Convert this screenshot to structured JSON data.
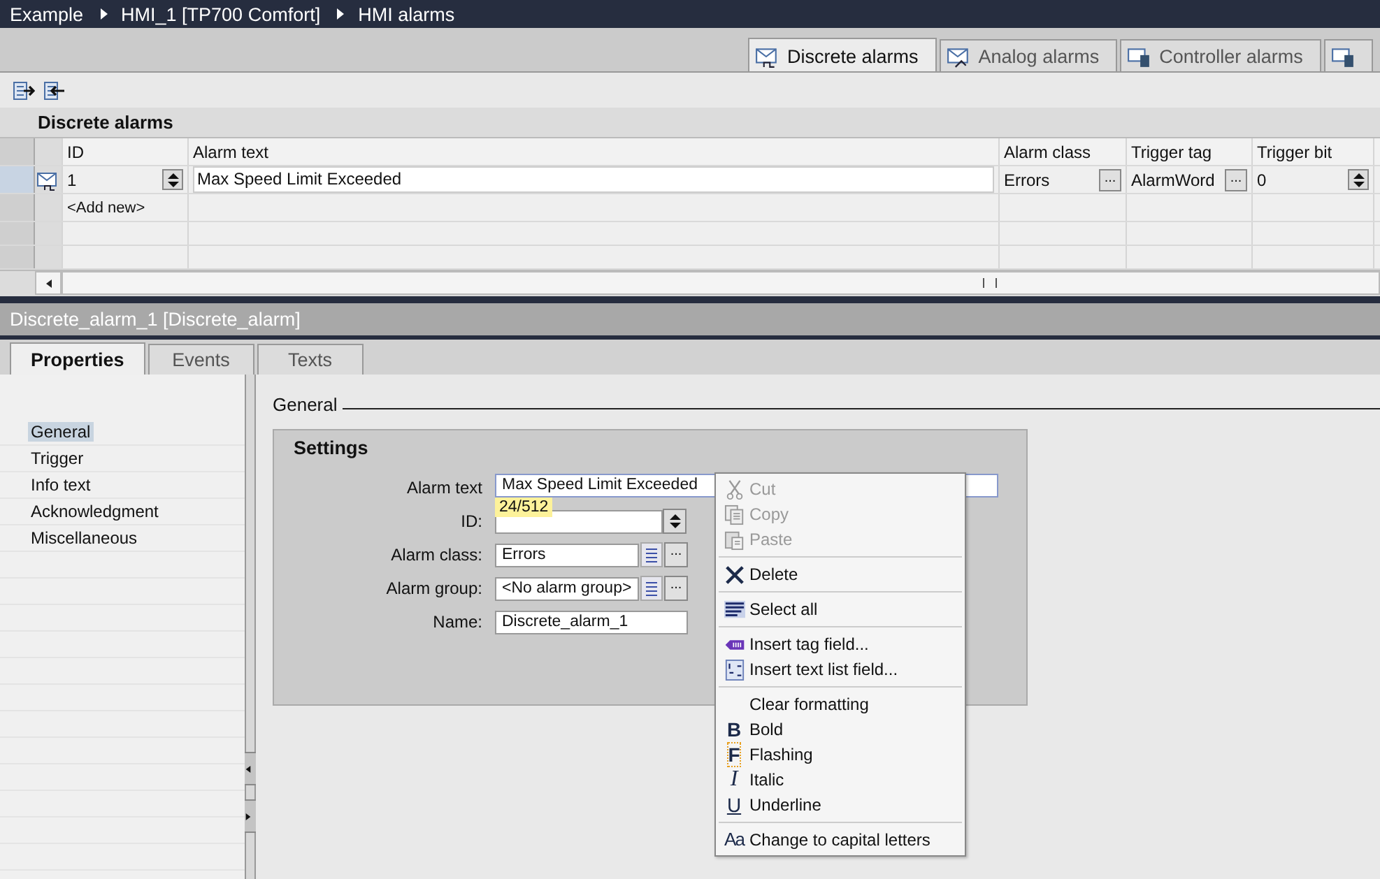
{
  "breadcrumb": [
    "Example",
    "HMI_1 [TP700 Comfort]",
    "HMI alarms"
  ],
  "editor_tabs": [
    {
      "label": "Discrete alarms",
      "selected": true
    },
    {
      "label": "Analog alarms",
      "selected": false
    },
    {
      "label": "Controller alarms",
      "selected": false
    },
    {
      "selected": false
    }
  ],
  "table": {
    "title": "Discrete alarms",
    "columns": [
      "ID",
      "Alarm text",
      "Alarm class",
      "Trigger tag",
      "Trigger bit"
    ],
    "rows": [
      {
        "id": "1",
        "alarm_text": "Max Speed Limit Exceeded",
        "alarm_class": "Errors",
        "alarm_class_button": "...",
        "trigger_tag": "AlarmWord",
        "trigger_tag_button": "...",
        "trigger_bit": "0",
        "selected": true
      }
    ],
    "add_new": "<Add new>"
  },
  "inspector": {
    "title": "Discrete_alarm_1 [Discrete_alarm]",
    "tabs": [
      {
        "label": "Properties",
        "selected": true
      },
      {
        "label": "Events",
        "selected": false
      },
      {
        "label": "Texts",
        "selected": false
      }
    ],
    "nav": [
      {
        "label": "General",
        "selected": true
      },
      {
        "label": "Trigger",
        "selected": false
      },
      {
        "label": "Info text",
        "selected": false
      },
      {
        "label": "Acknowledgment",
        "selected": false
      },
      {
        "label": "Miscellaneous",
        "selected": false
      }
    ],
    "section": "General",
    "group": "Settings",
    "fields": [
      {
        "label": "Alarm text",
        "kind": "wide",
        "value": "Max Speed Limit Exceeded",
        "counter": "24/512"
      },
      {
        "label": "ID:",
        "kind": "spin"
      },
      {
        "label": "Alarm class:",
        "kind": "picker",
        "value": "Errors",
        "button": "..."
      },
      {
        "label": "Alarm group:",
        "kind": "picker",
        "value": "<No alarm group>",
        "button": "..."
      },
      {
        "label": "Name:",
        "kind": "text",
        "value": "Discrete_alarm_1"
      }
    ]
  },
  "context_menu": [
    [
      {
        "label": "Cut",
        "disabled": true
      },
      {
        "label": "Copy",
        "disabled": true
      },
      {
        "label": "Paste",
        "disabled": true
      }
    ],
    [
      {
        "label": "Delete",
        "disabled": false
      }
    ],
    [
      {
        "label": "Select all",
        "disabled": false
      }
    ],
    [
      {
        "label": "Insert tag field...",
        "disabled": false
      },
      {
        "label": "Insert text list field...",
        "disabled": false
      }
    ],
    [
      {
        "label": "Clear formatting",
        "disabled": false
      },
      {
        "label": "Bold",
        "disabled": false,
        "glyph": "B"
      },
      {
        "label": "Flashing",
        "disabled": false,
        "glyph": "F"
      },
      {
        "label": "Italic",
        "disabled": false,
        "glyph": "I"
      },
      {
        "label": "Underline",
        "disabled": false,
        "glyph": "U"
      }
    ],
    [
      {
        "label": "Change to capital letters",
        "disabled": false,
        "glyph": "Aa"
      }
    ]
  ]
}
